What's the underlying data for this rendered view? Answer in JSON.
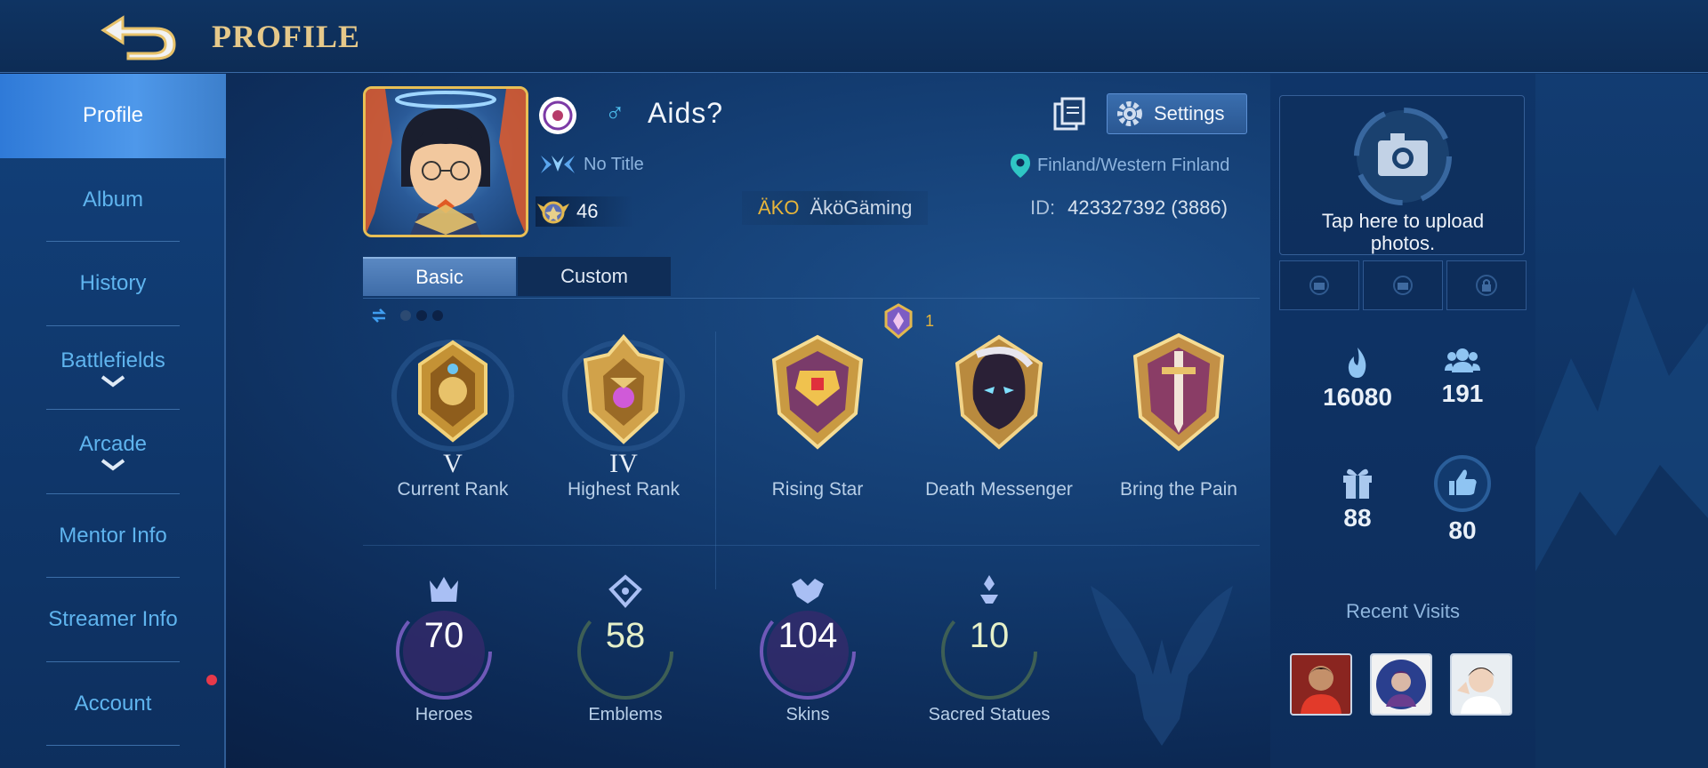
{
  "header": {
    "title": "PROFILE"
  },
  "sidebar": {
    "items": [
      {
        "label": "Profile"
      },
      {
        "label": "Album"
      },
      {
        "label": "History"
      },
      {
        "label": "Battlefields"
      },
      {
        "label": "Arcade"
      },
      {
        "label": "Mentor Info"
      },
      {
        "label": "Streamer Info"
      },
      {
        "label": "Account"
      }
    ]
  },
  "profile": {
    "username": "Aids?",
    "gender_symbol": "♂",
    "title": "No Title",
    "level": "46",
    "squad_tag": "ÄKO",
    "squad_name": "ÄköGäming",
    "location": "Finland/Western Finland",
    "id_label": "ID:",
    "id_value": "423327392 (3886)",
    "settings_label": "Settings"
  },
  "tabs": [
    {
      "label": "Basic"
    },
    {
      "label": "Custom"
    }
  ],
  "mythic_count": "1",
  "achievements": [
    {
      "roman": "V",
      "label": "Current Rank"
    },
    {
      "roman": "IV",
      "label": "Highest Rank"
    },
    {
      "roman": "",
      "label": "Rising Star"
    },
    {
      "roman": "",
      "label": "Death Messenger"
    },
    {
      "roman": "",
      "label": "Bring the Pain"
    }
  ],
  "stats": [
    {
      "value": "70",
      "label": "Heroes"
    },
    {
      "value": "58",
      "label": "Emblems"
    },
    {
      "value": "104",
      "label": "Skins"
    },
    {
      "value": "10",
      "label": "Sacred Statues"
    }
  ],
  "right_panel": {
    "upload_text_line1": "Tap here to upload",
    "upload_text_line2": "photos.",
    "popularity": "16080",
    "followers": "191",
    "gifts": "88",
    "likes": "80",
    "recent_visits_label": "Recent Visits"
  },
  "colors": {
    "gold": "#e6c98a",
    "accent_blue": "#5fb4ee",
    "notification_red": "#e6394a",
    "squad_gold": "#e7b53a"
  }
}
